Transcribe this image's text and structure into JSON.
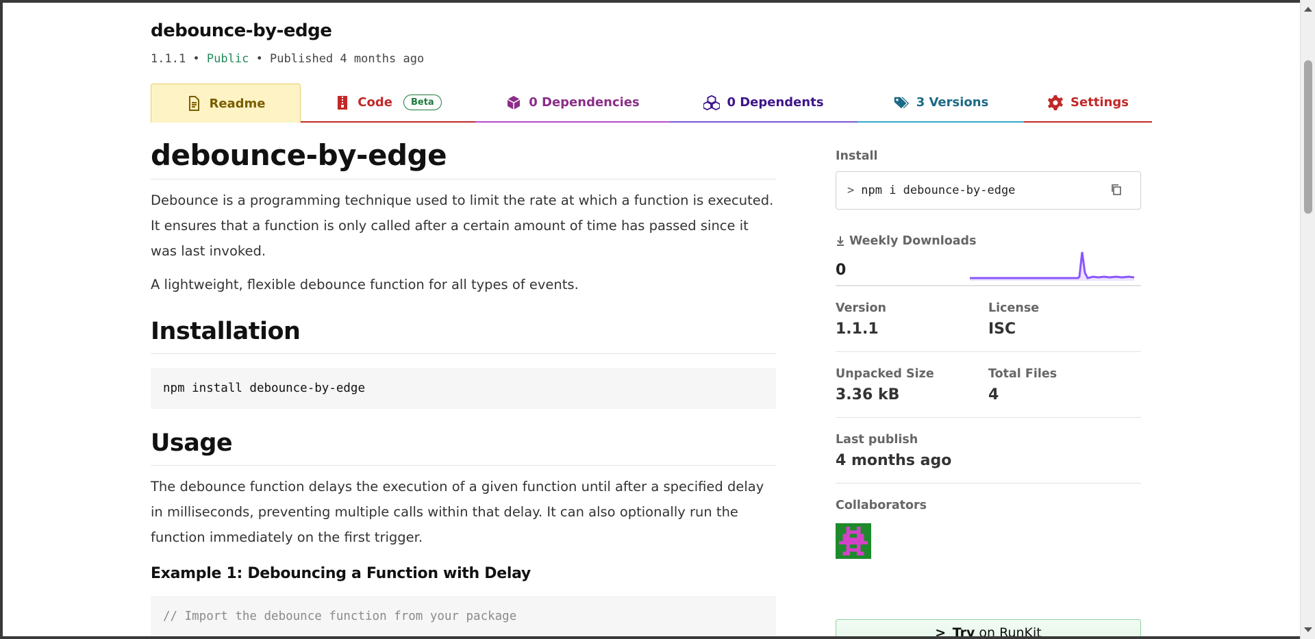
{
  "package": {
    "name": "debounce-by-edge",
    "version": "1.1.1",
    "separator1": " • ",
    "visibility": "Public",
    "separator2": " • ",
    "published": "Published 4 months ago"
  },
  "tabs": {
    "readme": "Readme",
    "code": "Code",
    "code_badge": "Beta",
    "dependencies": "0 Dependencies",
    "dependents": "0 Dependents",
    "versions": "3 Versions",
    "settings": "Settings"
  },
  "readme": {
    "title": "debounce-by-edge",
    "intro": "Debounce is a programming technique used to limit the rate at which a function is executed. It ensures that a function is only called after a certain amount of time has passed since it was last invoked.",
    "tagline": "A lightweight, flexible debounce function for all types of events.",
    "installation_heading": "Installation",
    "install_command": "npm install debounce-by-edge",
    "usage_heading": "Usage",
    "usage_text": "The debounce function delays the execution of a given function until after a specified delay in milliseconds, preventing multiple calls within that delay. It can also optionally run the function immediately on the first trigger.",
    "example1_heading": "Example 1: Debouncing a Function with Delay",
    "example1_code_first_line": "// Import the debounce function from your package"
  },
  "sidebar": {
    "install_label": "Install",
    "install_prompt": ">",
    "install_cmd": "npm i debounce-by-edge",
    "weekly_downloads_label": "Weekly Downloads",
    "weekly_downloads_value": "0",
    "version_label": "Version",
    "version_value": "1.1.1",
    "license_label": "License",
    "license_value": "ISC",
    "unpacked_label": "Unpacked Size",
    "unpacked_value": "3.36 kB",
    "files_label": "Total Files",
    "files_value": "4",
    "last_publish_label": "Last publish",
    "last_publish_value": "4 months ago",
    "collaborators_label": "Collaborators",
    "runkit_prefix": ">_",
    "runkit_try": "Try",
    "runkit_rest": " on RunKit"
  },
  "colors": {
    "public": "#218a5a",
    "sparkline": "#8956ff"
  },
  "icons": {
    "readme": "document-icon",
    "code": "zip-file-icon",
    "dependencies": "box-icon",
    "dependents": "boxes-icon",
    "versions": "tags-icon",
    "settings": "gear-icon",
    "copy": "copy-icon",
    "download": "download-icon"
  }
}
